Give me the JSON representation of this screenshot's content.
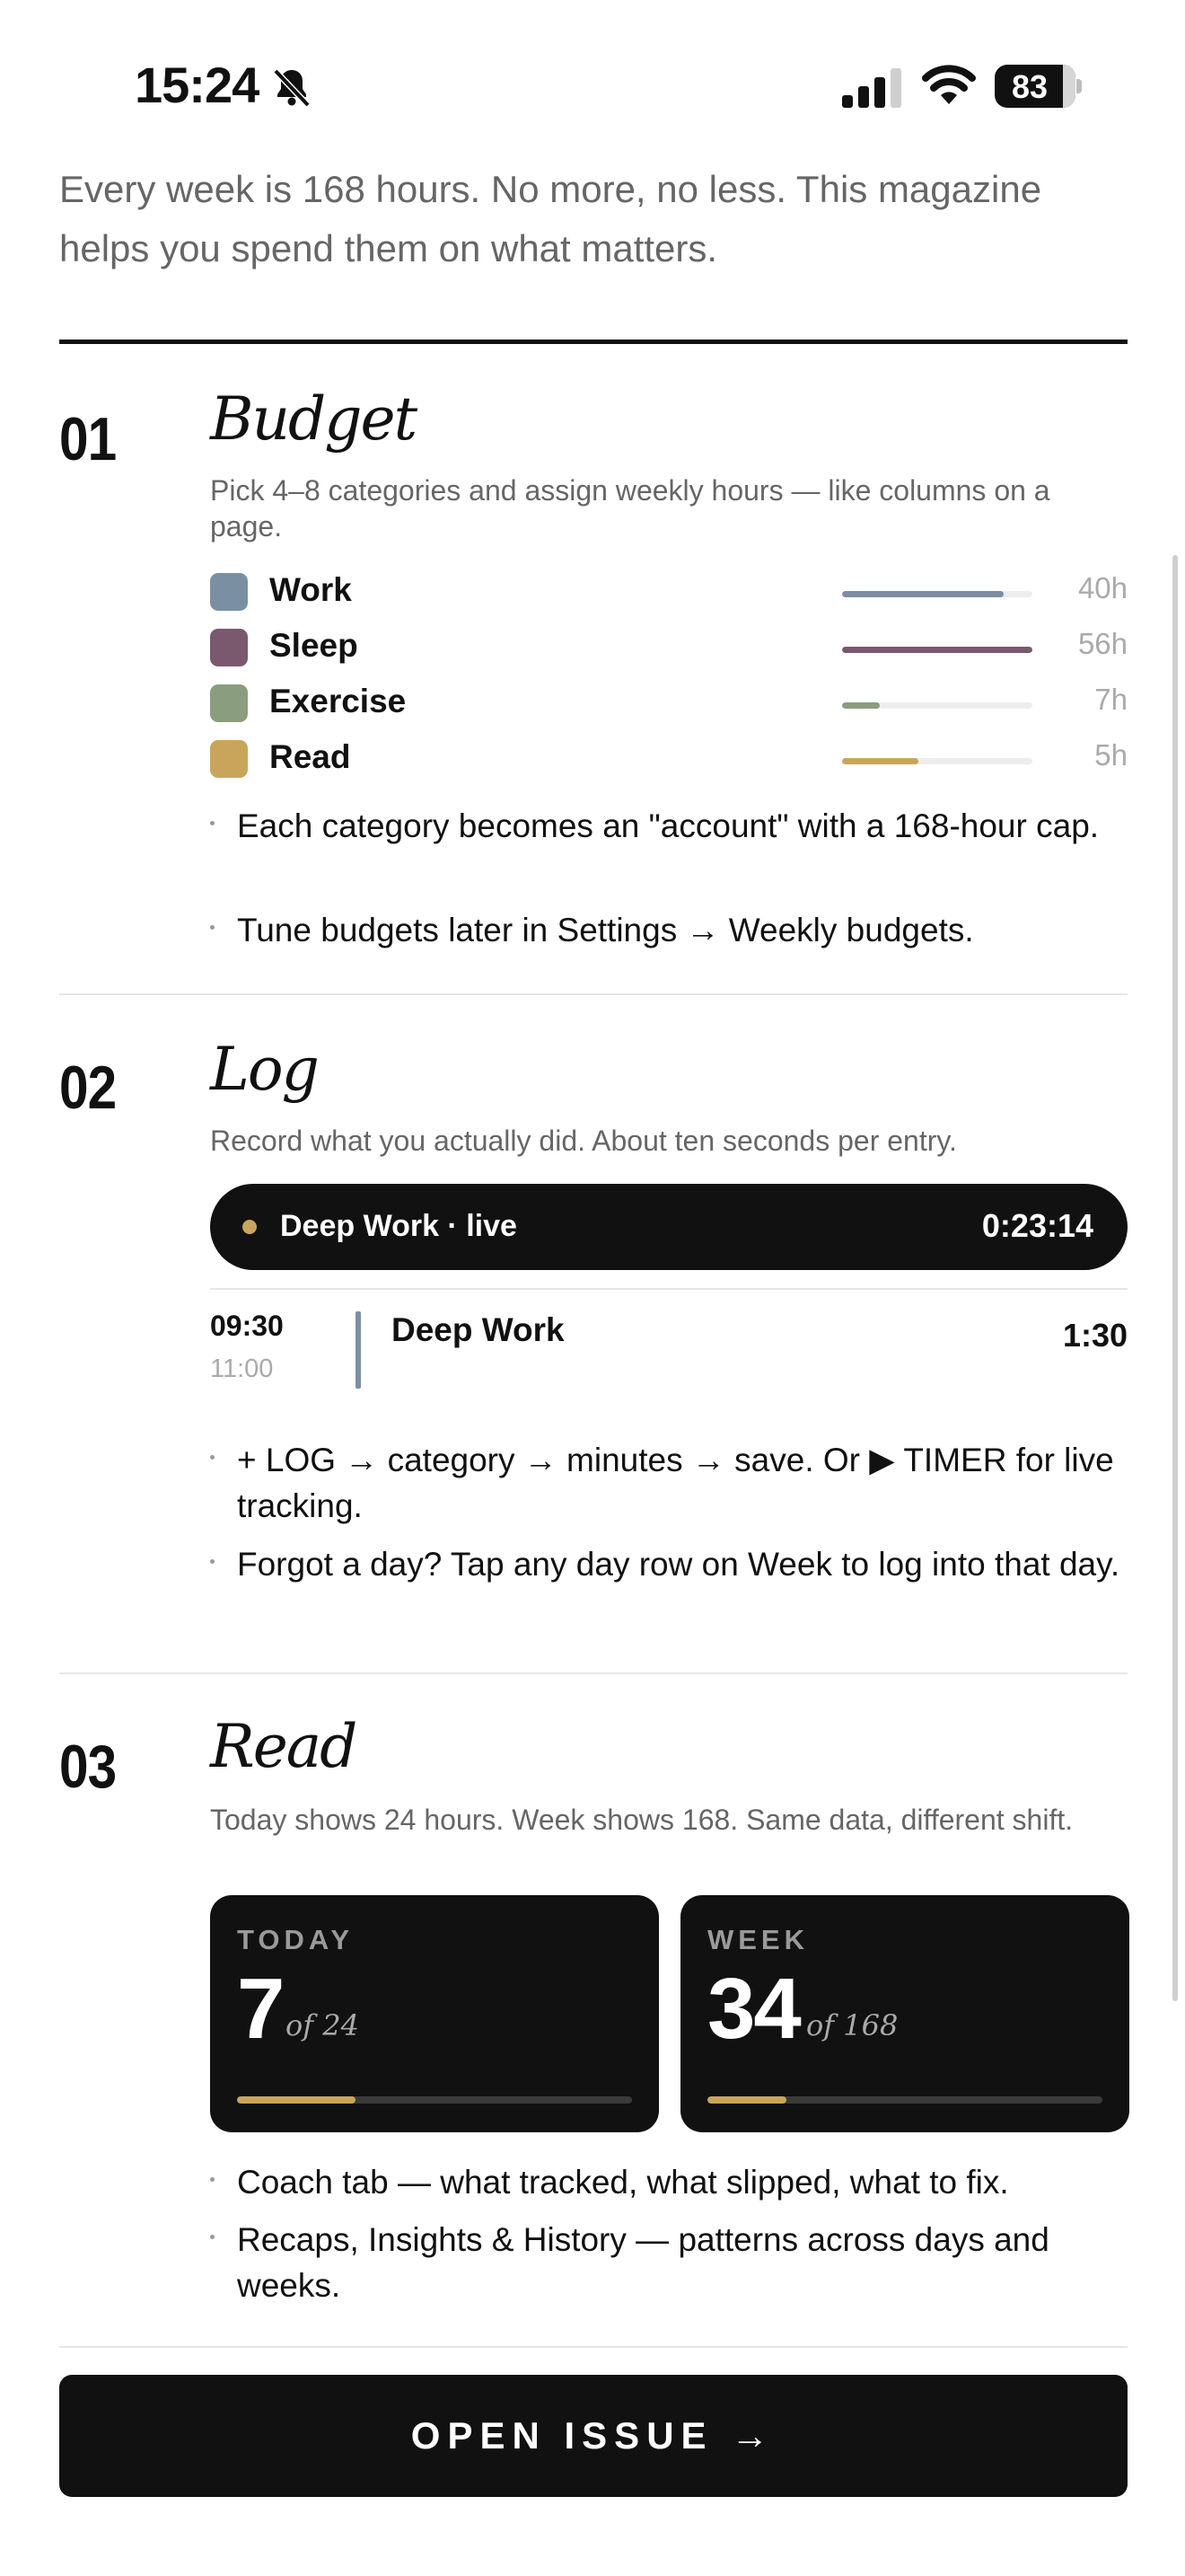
{
  "status_bar": {
    "time": "15:24",
    "battery": "83"
  },
  "intro": "Every week is 168 hours. No more, no less. This magazine helps you spend them on what matters.",
  "sections": [
    {
      "number": "01",
      "title": "Budget",
      "description": "Pick 4–8 categories and assign weekly hours — like columns on a page.",
      "bullets": [
        "Each category becomes an \"account\" with a 168-hour cap.",
        "Tune budgets later in Settings → Weekly budgets."
      ]
    },
    {
      "number": "02",
      "title": "Log",
      "description": "Record what you actually did. About ten seconds per entry.",
      "bullets": [
        "+ LOG → category → minutes → save. Or ▶ TIMER for live tracking.",
        "Forgot a day? Tap any day row on Week to log into that day."
      ]
    },
    {
      "number": "03",
      "title": "Read",
      "description": "Today shows 24 hours. Week shows 168. Same data, different shift.",
      "bullets": [
        "Coach tab — what tracked, what slipped, what to fix.",
        "Recaps, Insights & History — patterns across days and weeks."
      ]
    }
  ],
  "categories": [
    {
      "name": "Work",
      "hours": "40h",
      "color": "#7b8fa3",
      "fraction": 0.85
    },
    {
      "name": "Sleep",
      "hours": "56h",
      "color": "#7a586e",
      "fraction": 1.0
    },
    {
      "name": "Exercise",
      "hours": "7h",
      "color": "#8a9d7f",
      "fraction": 0.2
    },
    {
      "name": "Read",
      "hours": "5h",
      "color": "#c9a55c",
      "fraction": 0.4
    }
  ],
  "live_timer": {
    "label": "Deep Work · live",
    "elapsed": "0:23:14"
  },
  "log_entry": {
    "start": "09:30",
    "end": "11:00",
    "name": "Deep Work",
    "duration": "1:30"
  },
  "stats": {
    "today": {
      "label": "TODAY",
      "value": "7",
      "of": "of 24",
      "fraction": 0.3
    },
    "week": {
      "label": "WEEK",
      "value": "34",
      "of": "of 168",
      "fraction": 0.2
    }
  },
  "button": {
    "label": "OPEN ISSUE →"
  },
  "colors": {
    "ink": "#111111",
    "muted": "#666666",
    "accent": "#c9a55c"
  }
}
